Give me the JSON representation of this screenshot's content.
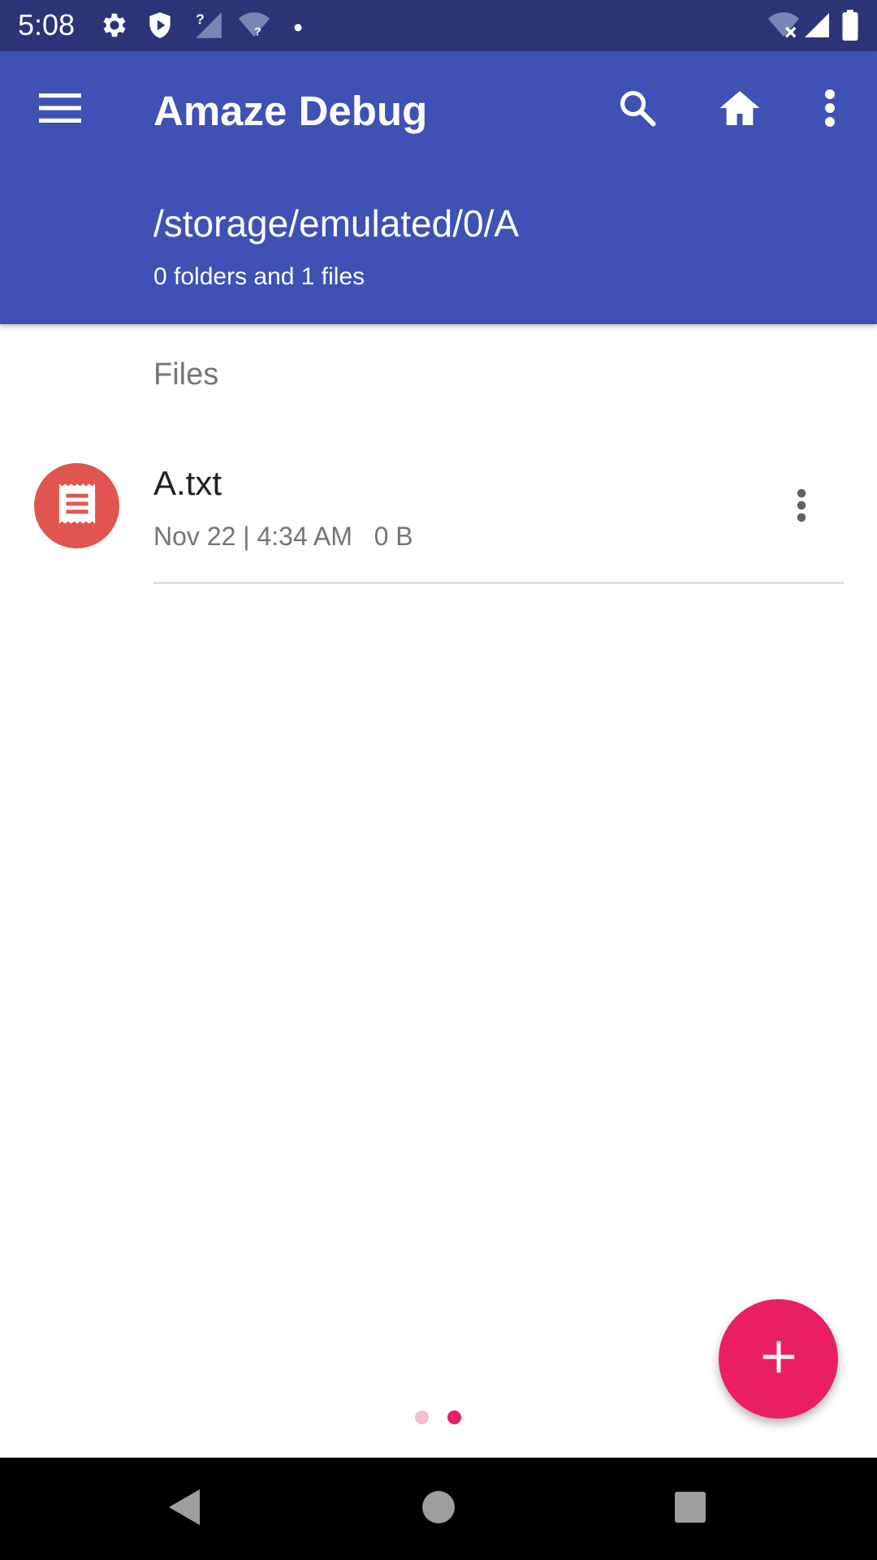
{
  "status_bar": {
    "time": "5:08",
    "icons": [
      "gear-icon",
      "shield-icon",
      "signal-unknown-icon",
      "wifi-unknown-icon",
      "notification-dot-icon",
      "wifi-off-icon",
      "cell-signal-icon",
      "battery-icon"
    ]
  },
  "app_bar": {
    "title": "Amaze Debug",
    "path": "/storage/emulated/0/A",
    "summary": "0 folders and 1 files",
    "actions": [
      "menu-icon",
      "search-icon",
      "home-icon",
      "more-vert-icon"
    ],
    "background_color": "#3f51b5",
    "status_bar_color": "#2c3477"
  },
  "content": {
    "section_header": "Files",
    "files": [
      {
        "name": "A.txt",
        "meta": "Nov 22 | 4:34 AM   0 B",
        "icon": "text-file-icon",
        "icon_color": "#e0564f"
      }
    ]
  },
  "fab": {
    "icon": "plus-icon",
    "color": "#e91e63"
  },
  "page_indicator": {
    "count": 2,
    "active_index": 1,
    "active_color": "#e91e63",
    "inactive_color": "#f8bbd0"
  },
  "nav_bar": {
    "buttons": [
      "back-icon",
      "home-circle-icon",
      "recents-icon"
    ]
  }
}
